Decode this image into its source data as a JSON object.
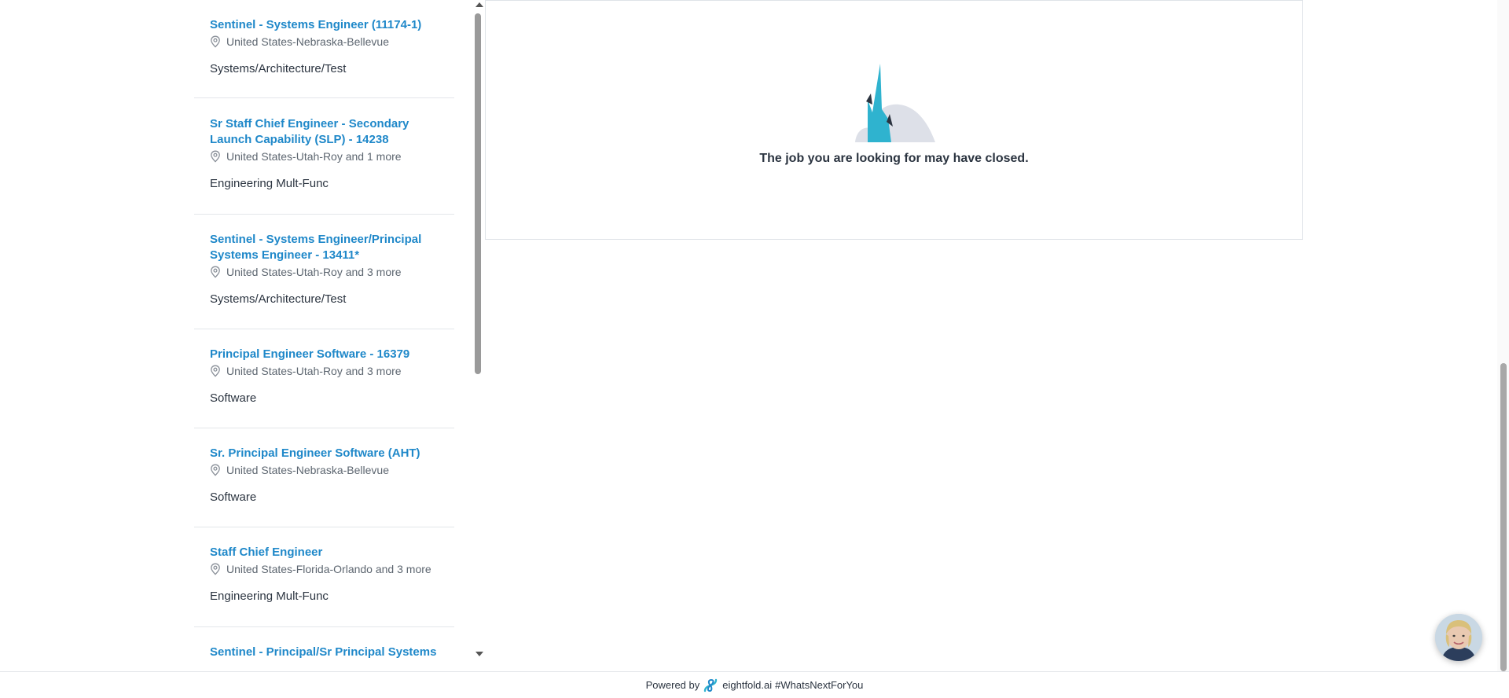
{
  "jobs": [
    {
      "title": "Sentinel - Systems Engineer (11174-1)",
      "location": "United States-Nebraska-Bellevue",
      "category": "Systems/Architecture/Test"
    },
    {
      "title": "Sr Staff Chief Engineer - Secondary Launch Capability (SLP) - 14238",
      "location": "United States-Utah-Roy and 1 more",
      "category": "Engineering Mult-Func"
    },
    {
      "title": "Sentinel - Systems Engineer/Principal Systems Engineer - 13411*",
      "location": "United States-Utah-Roy and 3 more",
      "category": "Systems/Architecture/Test"
    },
    {
      "title": "Principal Engineer Software - 16379",
      "location": "United States-Utah-Roy and 3 more",
      "category": "Software"
    },
    {
      "title": "Sr. Principal Engineer Software (AHT)",
      "location": "United States-Nebraska-Bellevue",
      "category": "Software"
    },
    {
      "title": "Staff Chief Engineer",
      "location": "United States-Florida-Orlando and 3 more",
      "category": "Engineering Mult-Func"
    },
    {
      "title": "Sentinel - Principal/Sr Principal Systems",
      "location": "",
      "category": ""
    }
  ],
  "detail": {
    "closed_message": "The job you are looking for may have closed."
  },
  "footer": {
    "powered_by": "Powered by",
    "brand": "eightfold.ai",
    "hashtag": "#WhatsNextForYou"
  },
  "colors": {
    "link": "#1f88c9",
    "text": "#2b3440",
    "muted": "#5d6670",
    "illustration_teal": "#2fb3cf",
    "illustration_gray": "#dde0e8"
  },
  "icons": {
    "location": "location-pin-icon",
    "footer_logo": "eightfold-logo-icon",
    "avatar": "assistant-avatar"
  }
}
